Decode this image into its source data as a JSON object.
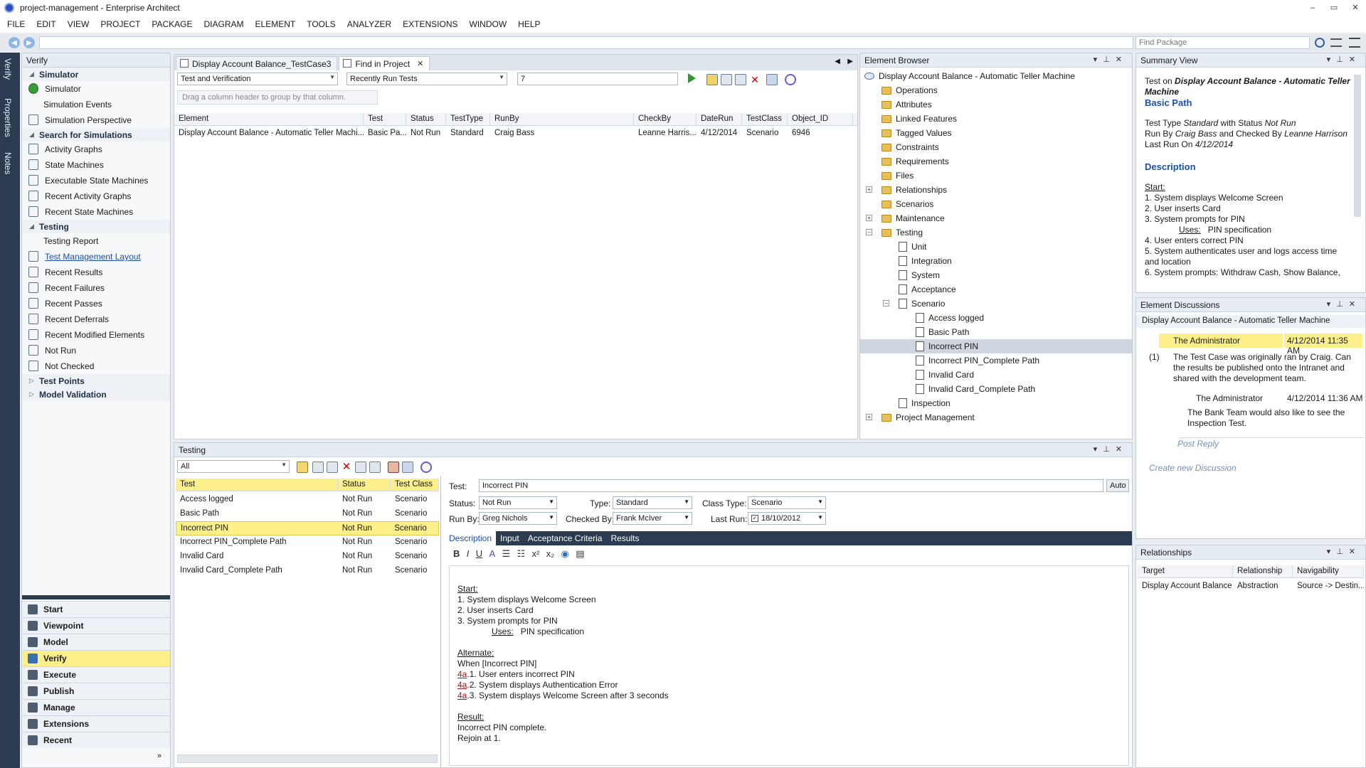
{
  "window": {
    "title": "project-management - Enterprise Architect",
    "controls": [
      "–",
      "▭",
      "✕"
    ]
  },
  "menu": [
    "FILE",
    "EDIT",
    "VIEW",
    "PROJECT",
    "PACKAGE",
    "DIAGRAM",
    "ELEMENT",
    "TOOLS",
    "ANALYZER",
    "EXTENSIONS",
    "WINDOW",
    "HELP"
  ],
  "address": {
    "find_placeholder": "Find Package"
  },
  "side_strip": [
    "Verify",
    "Properties",
    "Notes"
  ],
  "verify": {
    "title": "Verify",
    "sections": {
      "simulator": "Simulator",
      "search_simulations": "Search for Simulations",
      "testing": "Testing",
      "test_points": "Test Points",
      "model_validation": "Model Validation"
    },
    "simulator_items": [
      "Simulator",
      "Simulation Events",
      "Simulation Perspective"
    ],
    "search_items": [
      "Activity Graphs",
      "State Machines",
      "Executable State Machines",
      "Recent Activity Graphs",
      "Recent State Machines"
    ],
    "testing_items": [
      "Testing Report",
      "Test Management Layout",
      "Recent Results",
      "Recent Failures",
      "Recent Passes",
      "Recent Deferrals",
      "Recent Modified Elements",
      "Not Run",
      "Not Checked"
    ],
    "buttons": [
      "Start",
      "Viewpoint",
      "Model",
      "Verify",
      "Execute",
      "Publish",
      "Manage",
      "Extensions",
      "Recent"
    ],
    "collapse": "»"
  },
  "tabs": {
    "doc_tab": "Display Account Balance_TestCase3",
    "find_tab": "Find in Project"
  },
  "find": {
    "scope": "Test and Verification",
    "search": "Recently Run Tests",
    "term": "7",
    "group_hint": "Drag a column header to group by that column.",
    "columns": [
      "Element",
      "Test",
      "Status",
      "TestType",
      "RunBy",
      "CheckBy",
      "DateRun",
      "TestClass",
      "Object_ID"
    ],
    "rows": [
      [
        "Display Account Balance - Automatic Teller Machi...",
        "Basic Pa...",
        "Not Run",
        "Standard",
        "Craig Bass",
        "Leanne Harris...",
        "4/12/2014",
        "Scenario",
        "6946"
      ]
    ]
  },
  "browser": {
    "title": "Element Browser",
    "root": "Display Account Balance - Automatic Teller Machine",
    "nodes": [
      "Operations",
      "Attributes",
      "Linked Features",
      "Tagged Values",
      "Constraints",
      "Requirements",
      "Files",
      "Relationships",
      "Scenarios",
      "Maintenance",
      "Testing",
      "Unit",
      "Integration",
      "System",
      "Acceptance",
      "Scenario",
      "Access logged",
      "Basic Path",
      "Incorrect PIN",
      "Incorrect PIN_Complete Path",
      "Invalid Card",
      "Invalid Card_Complete Path",
      "Inspection",
      "Project Management"
    ]
  },
  "summary": {
    "title": "Summary View",
    "prefix": "Test on",
    "element": "Display Account Balance - Automatic Teller Machine",
    "test_name": "Basic Path",
    "l1": [
      "Test Type",
      "Standard",
      "with Status",
      "Not Run"
    ],
    "l2": [
      "Run By",
      "Craig Bass",
      "and Checked By",
      "Leanne Harrison"
    ],
    "l3": [
      "Last Run On",
      "4/12/2014"
    ],
    "desc_heading": "Description",
    "start": "Start:",
    "steps": [
      "1. System displays Welcome Screen",
      "2. User inserts Card",
      "3. System prompts for PIN",
      "4. User enters correct PIN",
      "5. System authenticates user and logs access time and location",
      "6. System prompts: Withdraw Cash, Show Balance,"
    ],
    "uses": "Uses:",
    "uses_val": "PIN specification"
  },
  "discussions": {
    "title": "Element Discussions",
    "element": "Display Account Balance - Automatic Teller Machine",
    "author1": "The Administrator",
    "date1": "4/12/2014 11:35 AM",
    "count": "(1)",
    "msg1": "The Test Case was originally ran by Craig. Can the results be published onto the Intranet and shared with the development team.",
    "author2": "The Administrator",
    "date2": "4/12/2014 11:36 AM",
    "msg2": "The Bank Team would also like to see the Inspection Test.",
    "post_reply": "Post Reply",
    "create_new": "Create new Discussion"
  },
  "relationships": {
    "title": "Relationships",
    "columns": [
      "Target",
      "Relationship",
      "Navigability"
    ],
    "rows": [
      [
        "Display Account Balance",
        "Abstraction",
        "Source -> Destin..."
      ]
    ]
  },
  "testing": {
    "title": "Testing",
    "filter": "All",
    "columns": [
      "Test",
      "Status",
      "Test Class"
    ],
    "rows": [
      [
        "Access logged",
        "Not Run",
        "Scenario"
      ],
      [
        "Basic Path",
        "Not Run",
        "Scenario"
      ],
      [
        "Incorrect PIN",
        "Not Run",
        "Scenario"
      ],
      [
        "Incorrect PIN_Complete Path",
        "Not Run",
        "Scenario"
      ],
      [
        "Invalid Card",
        "Not Run",
        "Scenario"
      ],
      [
        "Invalid Card_Complete Path",
        "Not Run",
        "Scenario"
      ]
    ],
    "form": {
      "test_label": "Test:",
      "test_value": "Incorrect PIN",
      "auto": "Auto",
      "status_label": "Status:",
      "status_value": "Not Run",
      "type_label": "Type:",
      "type_value": "Standard",
      "class_label": "Class Type:",
      "class_value": "Scenario",
      "runby_label": "Run By:",
      "runby_value": "Greg Nichols",
      "checked_label": "Checked By:",
      "checked_value": "Frank McIver",
      "lastrun_label": "Last Run:",
      "lastrun_value": "18/10/2012"
    },
    "subtabs": [
      "Description",
      "Input",
      "Acceptance Criteria",
      "Results"
    ],
    "desc": {
      "start": "Start:",
      "s1": "1. System displays Welcome Screen",
      "s2": "2. User inserts Card",
      "s3": "3. System prompts for PIN",
      "uses": "Uses:",
      "uses_val": "PIN specification",
      "alternate": "Alternate:",
      "when": "When [Incorrect PIN]",
      "a_prefix": "4a",
      "a1": ".1. User enters incorrect PIN",
      "a2": ".2. System displays Authentication Error",
      "a3": ".3. System displays Welcome Screen after 3 seconds",
      "result": "Result:",
      "r1": "Incorrect PIN complete.",
      "r2": "Rejoin at 1."
    }
  },
  "colors": {
    "accent": "#fdf08a",
    "sidebar_dark": "#2b3b52",
    "link": "#1a4fb0"
  }
}
